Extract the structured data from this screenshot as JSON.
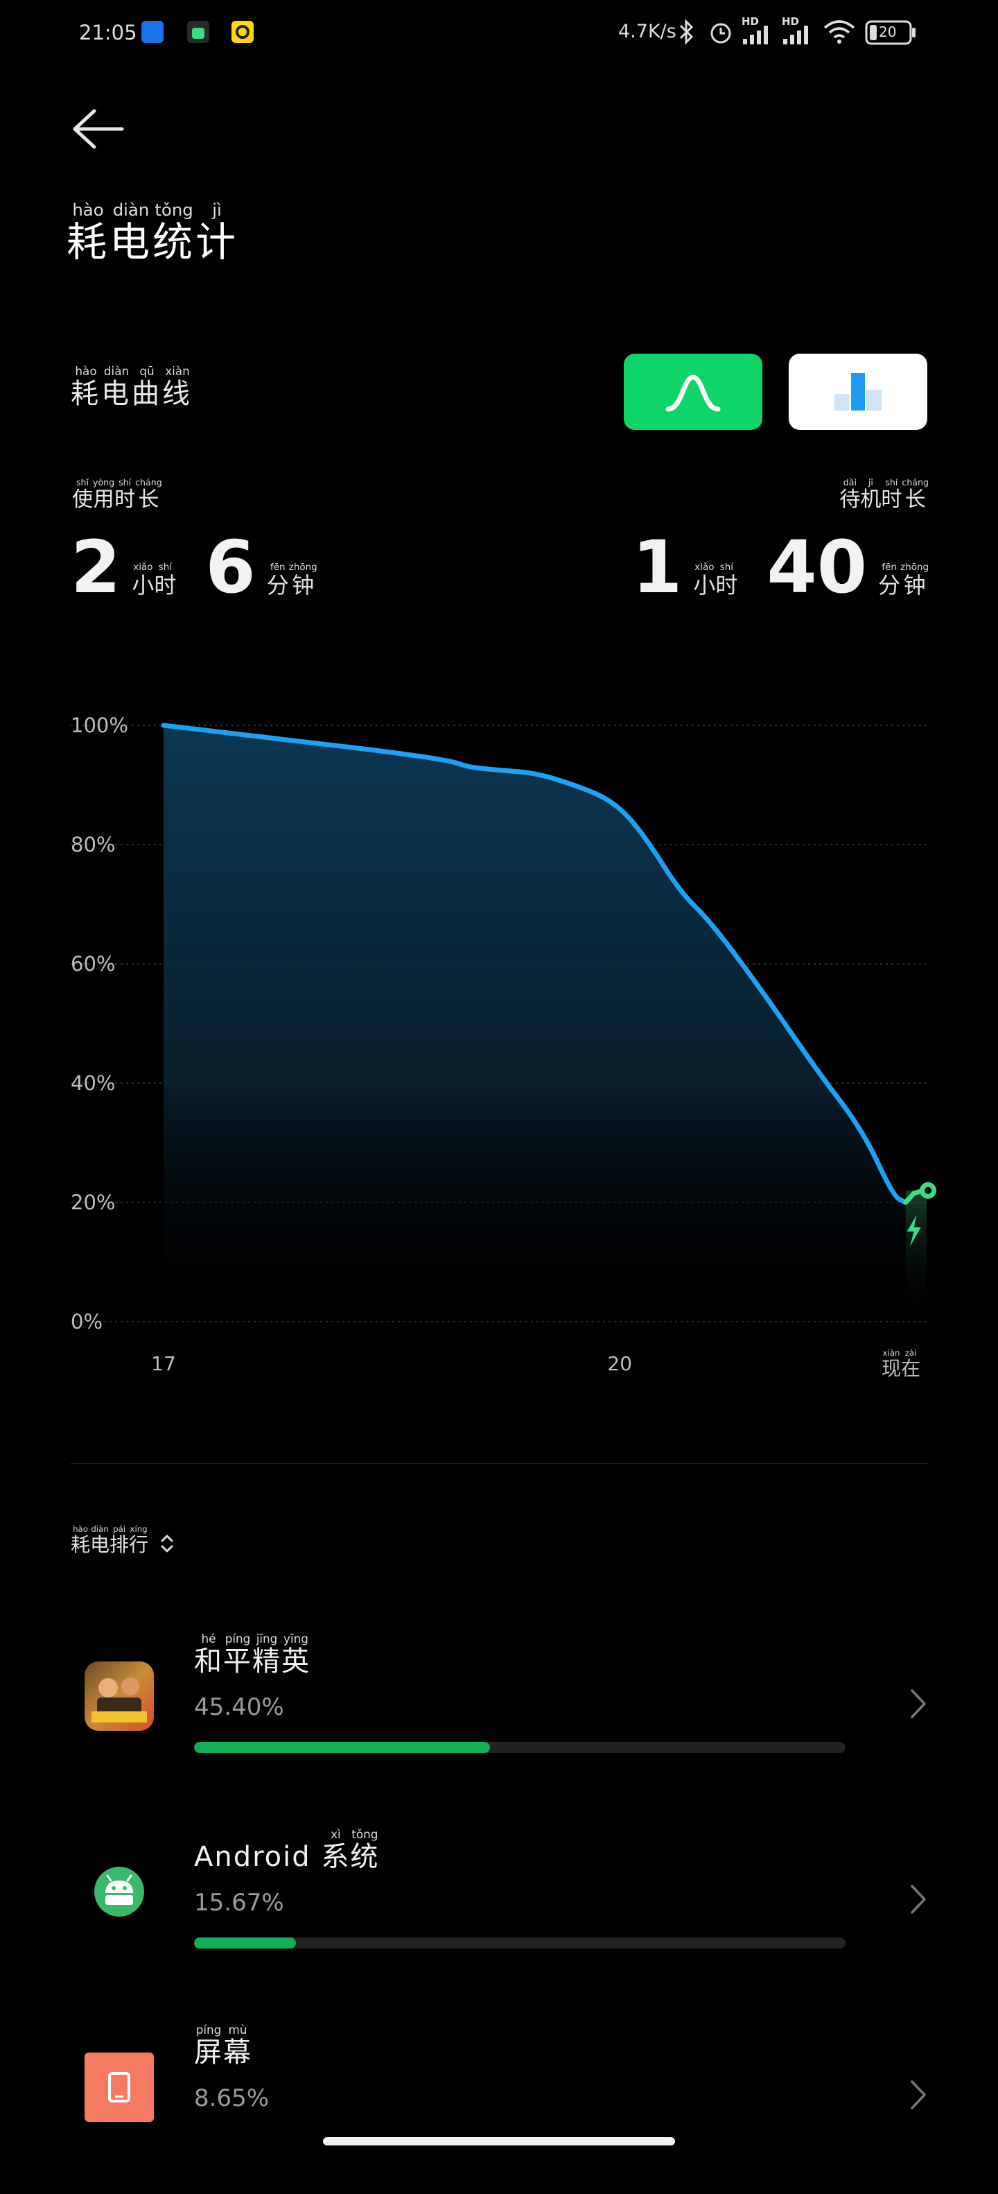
{
  "status_bar": {
    "time": "21:05",
    "net_speed": "4.7K/s",
    "battery_level": "20",
    "sim_labels": [
      "HD",
      "HD"
    ],
    "icons": [
      "kugou-app-icon",
      "android-notify-icon",
      "yellow-app-icon",
      "bluetooth-icon",
      "alarm-icon",
      "signal-icon",
      "signal-icon",
      "wifi-icon",
      "battery-icon"
    ]
  },
  "header": {
    "title_chars": [
      {
        "ch": "耗",
        "py": "hào"
      },
      {
        "ch": "电",
        "py": "diàn"
      },
      {
        "ch": "统",
        "py": "tǒng"
      },
      {
        "ch": "计",
        "py": "jì"
      }
    ]
  },
  "curve_section": {
    "title_chars": [
      {
        "ch": "耗",
        "py": "hào"
      },
      {
        "ch": "电",
        "py": "diàn"
      },
      {
        "ch": "曲",
        "py": "qū"
      },
      {
        "ch": "线",
        "py": "xiàn"
      }
    ],
    "toggle_curve_icon": "curve-icon",
    "toggle_bar_icon": "bar-chart-icon",
    "toggle_active": "curve"
  },
  "usage": {
    "label_chars": [
      {
        "ch": "使",
        "py": "shǐ"
      },
      {
        "ch": "用",
        "py": "yòng"
      },
      {
        "ch": "时",
        "py": "shí"
      },
      {
        "ch": "长",
        "py": "cháng"
      }
    ],
    "hours": "2",
    "minutes": "6",
    "hour_unit": [
      {
        "ch": "小",
        "py": "xiǎo"
      },
      {
        "ch": "时",
        "py": "shí"
      }
    ],
    "minute_unit": [
      {
        "ch": "分",
        "py": "fēn"
      },
      {
        "ch": "钟",
        "py": "zhōng"
      }
    ]
  },
  "standby": {
    "label_chars": [
      {
        "ch": "待",
        "py": "dài"
      },
      {
        "ch": "机",
        "py": "jī"
      },
      {
        "ch": "时",
        "py": "shí"
      },
      {
        "ch": "长",
        "py": "cháng"
      }
    ],
    "hours": "1",
    "minutes": "40",
    "hour_unit": [
      {
        "ch": "小",
        "py": "xiǎo"
      },
      {
        "ch": "时",
        "py": "shí"
      }
    ],
    "minute_unit": [
      {
        "ch": "分",
        "py": "fēn"
      },
      {
        "ch": "钟",
        "py": "zhōng"
      }
    ]
  },
  "chart_data": {
    "type": "area",
    "y_ticks": [
      "100%",
      "80%",
      "60%",
      "40%",
      "20%",
      "0%"
    ],
    "ylim": [
      0,
      100
    ],
    "x_tick_labels": [
      "17",
      "20"
    ],
    "x_end_label": [
      {
        "ch": "现",
        "py": "xiàn"
      },
      {
        "ch": "在",
        "py": "zài"
      }
    ],
    "x_unit": "hour",
    "xlim": [
      17,
      22.05
    ],
    "series": [
      {
        "x": [
          17.0,
          17.5,
          18.0,
          18.5,
          18.9,
          19.0,
          19.2,
          19.45,
          19.7,
          19.9,
          20.05,
          20.2,
          20.4,
          20.6,
          20.95,
          21.3,
          21.6,
          21.8,
          21.88
        ],
        "y": [
          100,
          98.5,
          97,
          95.5,
          94,
          93,
          92.5,
          92,
          90,
          88,
          85,
          80,
          72,
          67,
          55,
          42,
          32,
          21,
          20
        ]
      }
    ],
    "charging": {
      "x": [
        21.88,
        22.0
      ],
      "y": [
        20,
        22
      ],
      "icon": "charging-bolt-icon"
    },
    "grid": true,
    "line_color": "#1da1f2",
    "charge_color": "#3ddc84"
  },
  "ranking": {
    "sort_label": [
      {
        "ch": "耗",
        "py": "hào"
      },
      {
        "ch": "电",
        "py": "diàn"
      },
      {
        "ch": "排",
        "py": "pái"
      },
      {
        "ch": "行",
        "py": "xíng"
      }
    ],
    "sort_icon": "sort-updown-icon",
    "apps": [
      {
        "name_parts": [
          {
            "ch": "和",
            "py": "hé"
          },
          {
            "ch": "平",
            "py": "píng"
          },
          {
            "ch": "精",
            "py": "jīng"
          },
          {
            "ch": "英",
            "py": "yīng"
          }
        ],
        "percent_text": "45.40%",
        "percent": 45.4,
        "icon": "peace-elite-game-icon"
      },
      {
        "latin": "Android",
        "name_parts": [
          {
            "ch": "系",
            "py": "xì"
          },
          {
            "ch": "统",
            "py": "tǒng"
          }
        ],
        "percent_text": "15.67%",
        "percent": 15.67,
        "icon": "android-icon"
      },
      {
        "name_parts": [
          {
            "ch": "屏",
            "py": "píng"
          },
          {
            "ch": "幕",
            "py": "mù"
          }
        ],
        "percent_text": "8.65%",
        "percent": 8.65,
        "icon": "screen-icon"
      }
    ]
  },
  "colors": {
    "accent_green": "#0fd468",
    "bar_green": "#12b056",
    "line_blue": "#1da1f2",
    "screen_icon_bg": "#f47a62"
  }
}
